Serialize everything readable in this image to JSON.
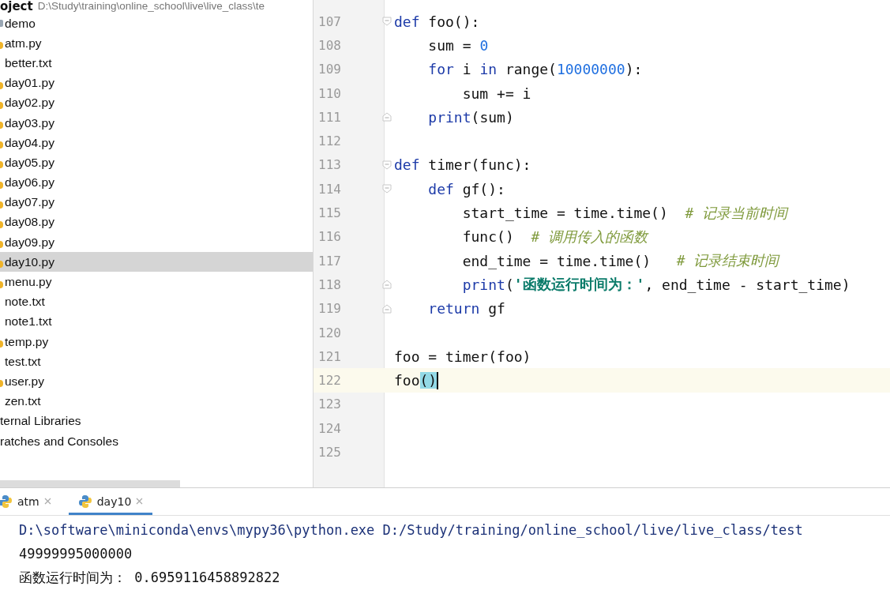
{
  "project": {
    "title": "oject",
    "path": "D:\\Study\\training\\online_school\\live\\live_class\\te"
  },
  "tree": [
    {
      "name": "demo",
      "kind": "folder",
      "selected": false
    },
    {
      "name": "atm.py",
      "kind": "python",
      "selected": false
    },
    {
      "name": "better.txt",
      "kind": "text",
      "selected": false
    },
    {
      "name": "day01.py",
      "kind": "python",
      "selected": false
    },
    {
      "name": "day02.py",
      "kind": "python",
      "selected": false
    },
    {
      "name": "day03.py",
      "kind": "python",
      "selected": false
    },
    {
      "name": "day04.py",
      "kind": "python",
      "selected": false
    },
    {
      "name": "day05.py",
      "kind": "python",
      "selected": false
    },
    {
      "name": "day06.py",
      "kind": "python",
      "selected": false
    },
    {
      "name": "day07.py",
      "kind": "python",
      "selected": false
    },
    {
      "name": "day08.py",
      "kind": "python",
      "selected": false
    },
    {
      "name": "day09.py",
      "kind": "python",
      "selected": false
    },
    {
      "name": "day10.py",
      "kind": "python",
      "selected": true
    },
    {
      "name": "menu.py",
      "kind": "python",
      "selected": false
    },
    {
      "name": "note.txt",
      "kind": "text",
      "selected": false
    },
    {
      "name": "note1.txt",
      "kind": "text",
      "selected": false
    },
    {
      "name": "temp.py",
      "kind": "python",
      "selected": false
    },
    {
      "name": "test.txt",
      "kind": "text",
      "selected": false
    },
    {
      "name": "user.py",
      "kind": "python",
      "selected": false
    },
    {
      "name": "zen.txt",
      "kind": "text",
      "selected": false
    },
    {
      "name": "ternal Libraries",
      "kind": "library",
      "selected": false
    },
    {
      "name": "ratches and Consoles",
      "kind": "scratch",
      "selected": false
    }
  ],
  "editor": {
    "lines": [
      {
        "number": "107",
        "fold_start": true,
        "fold_end": false,
        "current": false,
        "caret": false,
        "tokens": [
          {
            "text": "def",
            "kind": "keyword"
          },
          {
            "text": " foo():",
            "kind": "plain"
          }
        ]
      },
      {
        "number": "108",
        "fold_start": false,
        "fold_end": false,
        "current": false,
        "caret": false,
        "tokens": [
          {
            "text": "    sum = ",
            "kind": "plain"
          },
          {
            "text": "0",
            "kind": "number"
          }
        ]
      },
      {
        "number": "109",
        "fold_start": false,
        "fold_end": false,
        "current": false,
        "caret": false,
        "tokens": [
          {
            "text": "    for",
            "kind": "keyword"
          },
          {
            "text": " i ",
            "kind": "plain"
          },
          {
            "text": "in",
            "kind": "keyword"
          },
          {
            "text": " range(",
            "kind": "plain"
          },
          {
            "text": "10000000",
            "kind": "number"
          },
          {
            "text": "):",
            "kind": "plain"
          }
        ]
      },
      {
        "number": "110",
        "fold_start": false,
        "fold_end": false,
        "current": false,
        "caret": false,
        "tokens": [
          {
            "text": "        sum += i",
            "kind": "plain"
          }
        ]
      },
      {
        "number": "111",
        "fold_start": false,
        "fold_end": true,
        "current": false,
        "caret": false,
        "tokens": [
          {
            "text": "    print",
            "kind": "builtin"
          },
          {
            "text": "(sum)",
            "kind": "plain"
          }
        ]
      },
      {
        "number": "112",
        "fold_start": false,
        "fold_end": false,
        "current": false,
        "caret": false
      },
      {
        "number": "113",
        "fold_start": true,
        "fold_end": false,
        "current": false,
        "caret": false,
        "tokens": [
          {
            "text": "def",
            "kind": "keyword"
          },
          {
            "text": " timer(func):",
            "kind": "plain"
          }
        ]
      },
      {
        "number": "114",
        "fold_start": true,
        "fold_end": false,
        "current": false,
        "caret": false,
        "tokens": [
          {
            "text": "    def",
            "kind": "keyword"
          },
          {
            "text": " gf():",
            "kind": "plain"
          }
        ]
      },
      {
        "number": "115",
        "fold_start": false,
        "fold_end": false,
        "current": false,
        "caret": false,
        "tokens": [
          {
            "text": "        start_time = time.time()  ",
            "kind": "plain"
          },
          {
            "text": "# 记录当前时间",
            "kind": "comment"
          }
        ]
      },
      {
        "number": "116",
        "fold_start": false,
        "fold_end": false,
        "current": false,
        "caret": false,
        "tokens": [
          {
            "text": "        func()  ",
            "kind": "plain"
          },
          {
            "text": "# 调用传入的函数",
            "kind": "comment"
          }
        ]
      },
      {
        "number": "117",
        "fold_start": false,
        "fold_end": false,
        "current": false,
        "caret": false,
        "tokens": [
          {
            "text": "        end_time = time.time()   ",
            "kind": "plain"
          },
          {
            "text": "# 记录结束时间",
            "kind": "comment"
          }
        ]
      },
      {
        "number": "118",
        "fold_start": false,
        "fold_end": true,
        "current": false,
        "caret": false,
        "tokens": [
          {
            "text": "        print",
            "kind": "builtin"
          },
          {
            "text": "(",
            "kind": "plain"
          },
          {
            "text": "'函数运行时间为：'",
            "kind": "string"
          },
          {
            "text": ", end_time - start_time)",
            "kind": "plain"
          }
        ]
      },
      {
        "number": "119",
        "fold_start": false,
        "fold_end": true,
        "current": false,
        "caret": false,
        "tokens": [
          {
            "text": "    return",
            "kind": "keyword"
          },
          {
            "text": " gf",
            "kind": "plain"
          }
        ]
      },
      {
        "number": "120",
        "fold_start": false,
        "fold_end": false,
        "current": false,
        "caret": false
      },
      {
        "number": "121",
        "fold_start": false,
        "fold_end": false,
        "current": false,
        "caret": false,
        "tokens": [
          {
            "text": "foo = timer(foo)",
            "kind": "plain"
          }
        ]
      },
      {
        "number": "122",
        "fold_start": false,
        "fold_end": false,
        "current": true,
        "caret": true,
        "tokens": [
          {
            "text": "foo",
            "kind": "plain"
          },
          {
            "text": "()",
            "kind": "match"
          }
        ]
      },
      {
        "number": "123",
        "fold_start": false,
        "fold_end": false,
        "current": false,
        "caret": false
      },
      {
        "number": "124",
        "fold_start": false,
        "fold_end": false,
        "current": false,
        "caret": false
      },
      {
        "number": "125",
        "fold_start": false,
        "fold_end": false,
        "current": false,
        "caret": false
      }
    ]
  },
  "run_tabs": [
    {
      "label": "atm",
      "selected": false
    },
    {
      "label": "day10",
      "selected": true
    }
  ],
  "console": [
    {
      "text": "D:\\software\\miniconda\\envs\\mypy36\\python.exe D:/Study/training/online_school/live/live_class/test",
      "kind": "command"
    },
    {
      "text": "49999995000000",
      "kind": "output"
    },
    {
      "text": "函数运行时间为： 0.6959116458892822",
      "kind": "output"
    }
  ]
}
